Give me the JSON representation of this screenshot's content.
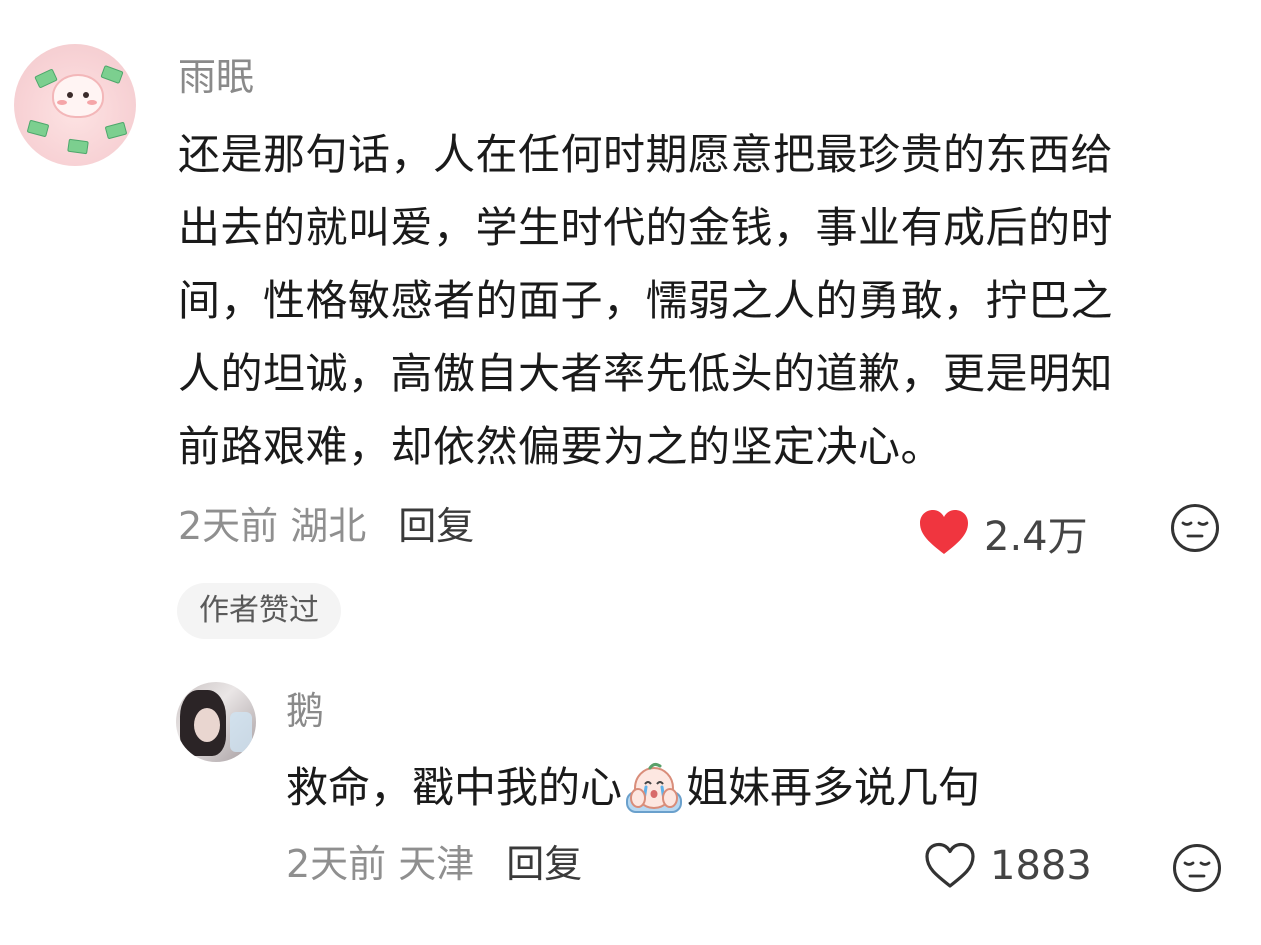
{
  "comment": {
    "username": "雨眠",
    "lines": [
      "还是那句话，人在任何时期愿意把最珍贵的东西给",
      "出去的就叫爱，学生时代的金钱，事业有成后的时",
      "间，性格敏感者的面子，懦弱之人的勇敢，拧巴之",
      "人的坦诚，高傲自大者率先低头的道歉，更是明知",
      "前路艰难，却依然偏要为之的坚定决心。"
    ],
    "time": "2天前",
    "location": "湖北",
    "reply_label": "回复",
    "like_count": "2.4万",
    "liked": true,
    "author_badge": "作者赞过"
  },
  "reply": {
    "username": "鹅",
    "text_before": "救命，戳中我的心",
    "text_after": "姐妹再多说几句",
    "time": "2天前",
    "location": "天津",
    "reply_label": "回复",
    "like_count": "1883",
    "liked": false
  },
  "icons": {
    "heart_filled": "heart-filled-icon",
    "heart_outline": "heart-outline-icon",
    "emoji": "neutral-face-icon",
    "sticker": "crying-emoji-sticker"
  },
  "colors": {
    "heart": "#f0353f",
    "meta_text": "#8f8f8f",
    "username": "#8a8a8a"
  }
}
